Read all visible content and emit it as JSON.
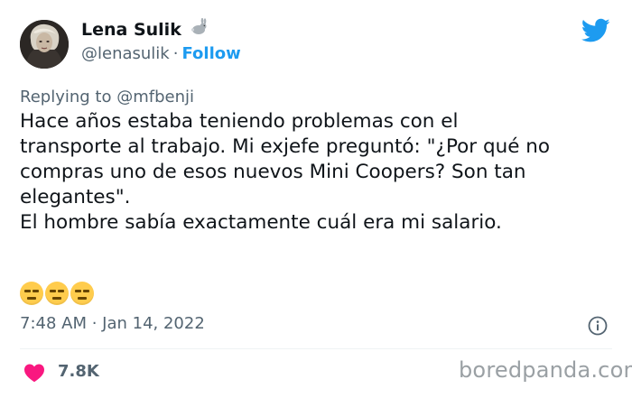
{
  "author": {
    "display_name": "Lena Sulik",
    "badge_icon": "rabbit-icon",
    "handle": "@lenasulik",
    "separator": "·",
    "follow_label": "Follow"
  },
  "reply": {
    "prefix": "Replying to",
    "mention": "@mfbenji"
  },
  "tweet": {
    "text": "Hace años estaba teniendo problemas con el\ntransporte al trabajo. Mi exjefe preguntó: \"¿Por qué no\ncompras uno de esos nuevos Mini Coopers? Son tan\nelegantes\".\nEl hombre sabía exactamente cuál era mi salario.",
    "emojis": [
      "expressionless-face",
      "expressionless-face",
      "expressionless-face"
    ],
    "timestamp": "7:48 AM · Jan 14, 2022"
  },
  "engagement": {
    "likes": "7.8K"
  },
  "watermark": "boredpanda.com",
  "colors": {
    "accent": "#1d9bf0",
    "heart": "#f91880",
    "secondary_text": "#536471",
    "emoji": "#ffcc4d"
  }
}
